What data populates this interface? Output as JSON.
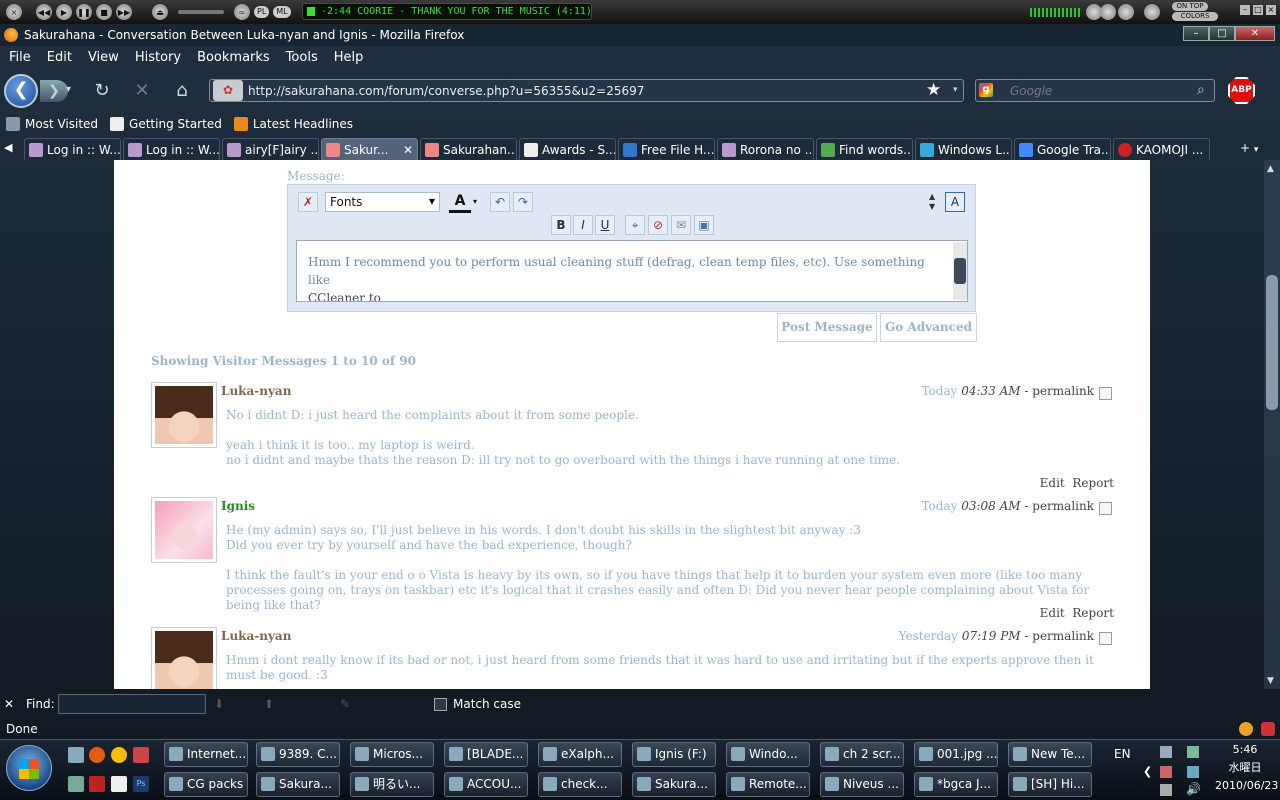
{
  "winamp": {
    "track": "-2:44  COORIE - THANK YOU FOR THE MUSIC (4:11)",
    "btn_on_top": "ON TOP",
    "btn_colors": "COLORS",
    "btn_pl": "PL",
    "btn_ml": "ML"
  },
  "window": {
    "title": "Sakurahana - Conversation Between Luka-nyan and Ignis - Mozilla Firefox"
  },
  "menu": [
    "File",
    "Edit",
    "View",
    "History",
    "Bookmarks",
    "Tools",
    "Help"
  ],
  "nav": {
    "url": "http://sakurahana.com/forum/converse.php?u=56355&u2=25697",
    "search_placeholder": "Google",
    "abp": "ABP"
  },
  "bookmarks": [
    "Most Visited",
    "Getting Started",
    "Latest Headlines"
  ],
  "tabs": [
    "Log in :: W...",
    "Log in :: W...",
    "airy[F]airy ...",
    "Sakur...",
    "Sakurahan...",
    "Awards - S...",
    "Free File H...",
    "Rorona no ...",
    "Find words...",
    "Windows L...",
    "Google Tra...",
    "KAOMOJI ..."
  ],
  "editor": {
    "label": "Message:",
    "font_select": "Fonts",
    "text_line1": "Hmm I recommend you to perform usual cleaning stuff (defrag, clean temp files, etc). Use something like",
    "text_line2": "CCleaner to",
    "post_button": "Post Message",
    "advanced_button": "Go Advanced"
  },
  "showing": "Showing Visitor Messages 1 to 10 of 90",
  "posts": [
    {
      "name": "Luka-nyan",
      "date": "Today",
      "time": "04:33 AM",
      "permalink": "permalink",
      "body": [
        "No i didnt D: i just heard the complaints about it from some people.",
        "yeah i think it is too.. my laptop is weird.\nno i didnt and maybe thats the reason D: ill try not to go overboard with the things i have running at one time."
      ],
      "edit": "Edit",
      "report": "Report"
    },
    {
      "name": "Ignis",
      "date": "Today",
      "time": "03:08 AM",
      "permalink": "permalink",
      "body": [
        "He (my admin) says so, I'll just believe in his words. I don't doubt his skills in the slightest bit anyway :3\nDid you ever try by yourself and have the bad experience, though?",
        "I think the fault's in your end o o Vista is heavy by its own, so if you have things that help it to burden your system even more (like too many processes going on, trays on taskbar) etc it's logical that it crashes easily and often D: Did you never hear people complaining about Vista for being like that?"
      ],
      "edit": "Edit",
      "report": "Report"
    },
    {
      "name": "Luka-nyan",
      "date": "Yesterday",
      "time": "07:19 PM",
      "permalink": "permalink",
      "body": [
        "Hmm i dont really know if its bad or not, i just heard from some friends that it was hard to use and irritating but if the experts approve then it must be good. :3"
      ]
    }
  ],
  "findbar": {
    "label": "Find:",
    "match_case": "Match case"
  },
  "status": "Done",
  "taskbar": {
    "row1": [
      "Internet...",
      "9389. C...",
      "Micros...",
      "[BLADE...",
      "eXalph...",
      "Ignis (F:)",
      "Windo...",
      "ch 2 scr...",
      "001.jpg ...",
      "New Te..."
    ],
    "row2": [
      "CG packs",
      "Sakura...",
      "明るい...",
      "ACCOU...",
      "check...",
      "Sakura...",
      "Remote...",
      "Niveus ...",
      "*bgca J...",
      "[SH] Hi..."
    ],
    "lang": "EN",
    "time": "5:46",
    "day": "水曜日",
    "date": "2010/06/23"
  },
  "colors": {
    "accent": "#9ab5cc",
    "name_luka": "#7a6a4a",
    "name_ignis": "#2a8a2a"
  }
}
